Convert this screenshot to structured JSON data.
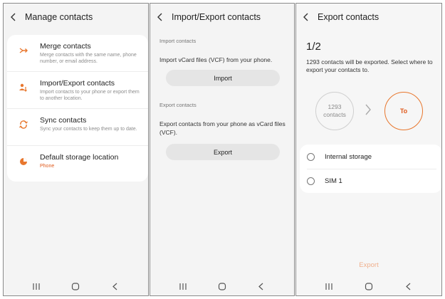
{
  "screen1": {
    "title": "Manage contacts",
    "items": [
      {
        "title": "Merge contacts",
        "desc": "Merge contacts with the same name, phone number, or email address.",
        "icon": "merge-icon"
      },
      {
        "title": "Import/Export contacts",
        "desc": "Import contacts to your phone or export them to another location.",
        "icon": "import-export-icon"
      },
      {
        "title": "Sync contacts",
        "desc": "Sync your contacts to keep them up to date.",
        "icon": "sync-icon"
      },
      {
        "title": "Default storage location",
        "desc": "Phone",
        "icon": "storage-pie-icon"
      }
    ]
  },
  "screen2": {
    "title": "Import/Export contacts",
    "import_section": "Import contacts",
    "import_desc": "Import vCard files (VCF) from your phone.",
    "import_button": "Import",
    "export_section": "Export contacts",
    "export_desc": "Export contacts from your phone as vCard files (VCF).",
    "export_button": "Export"
  },
  "screen3": {
    "title": "Export contacts",
    "step": "1/2",
    "desc": "1293 contacts will be exported. Select where to export your contacts to.",
    "source_count": "1293",
    "source_label": "contacts",
    "target_label": "To",
    "options": [
      "Internal storage",
      "SIM 1"
    ],
    "export_button": "Export"
  },
  "colors": {
    "accent": "#e05a1c",
    "accent_light": "#f0b08d",
    "background": "#f4f4f4",
    "card": "#ffffff"
  }
}
